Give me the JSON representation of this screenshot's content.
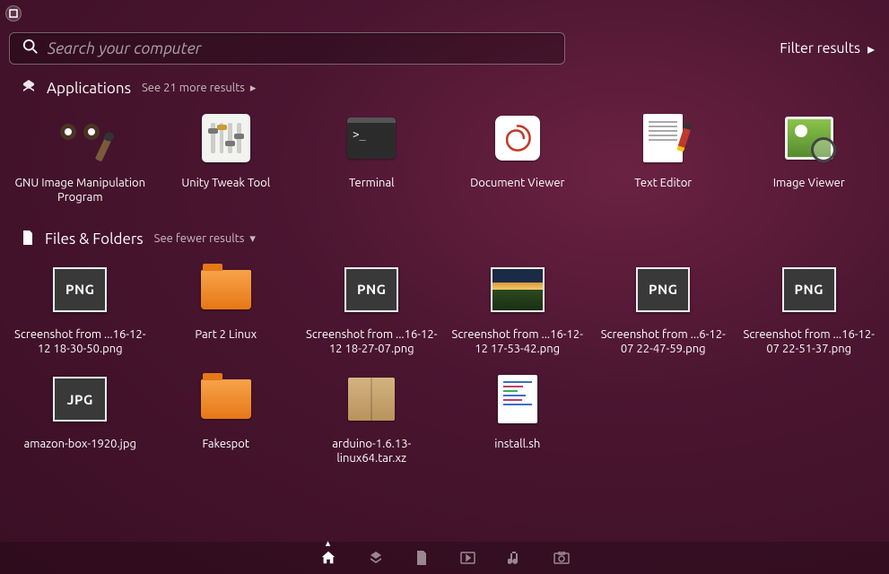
{
  "search": {
    "placeholder": "Search your computer"
  },
  "filter_label": "Filter results",
  "sections": {
    "applications": {
      "title": "Applications",
      "more": "See 21 more results",
      "items": [
        {
          "label": "GNU Image Manipulation Program"
        },
        {
          "label": "Unity Tweak Tool"
        },
        {
          "label": "Terminal"
        },
        {
          "label": "Document Viewer"
        },
        {
          "label": "Text Editor"
        },
        {
          "label": "Image Viewer"
        }
      ]
    },
    "files": {
      "title": "Files & Folders",
      "more": "See fewer results",
      "items": [
        {
          "label": "Screenshot from ...16-12-12 18-30-50.png",
          "type": "png"
        },
        {
          "label": "Part 2 Linux",
          "type": "folder"
        },
        {
          "label": "Screenshot from ...16-12-12 18-27-07.png",
          "type": "png"
        },
        {
          "label": "Screenshot from ...16-12-12 17-53-42.png",
          "type": "landscape"
        },
        {
          "label": "Screenshot from ...6-12-07 22-47-59.png",
          "type": "png"
        },
        {
          "label": "Screenshot from ...16-12-07 22-51-37.png",
          "type": "png"
        },
        {
          "label": "amazon-box-1920.jpg",
          "type": "jpg"
        },
        {
          "label": "Fakespot",
          "type": "folder"
        },
        {
          "label": "arduino-1.6.13-linux64.tar.xz",
          "type": "package"
        },
        {
          "label": "install.sh",
          "type": "script"
        }
      ]
    }
  },
  "lenses": [
    "home",
    "applications",
    "files",
    "video",
    "music",
    "photos"
  ],
  "thumb_text": {
    "png": "PNG",
    "jpg": "JPG"
  }
}
